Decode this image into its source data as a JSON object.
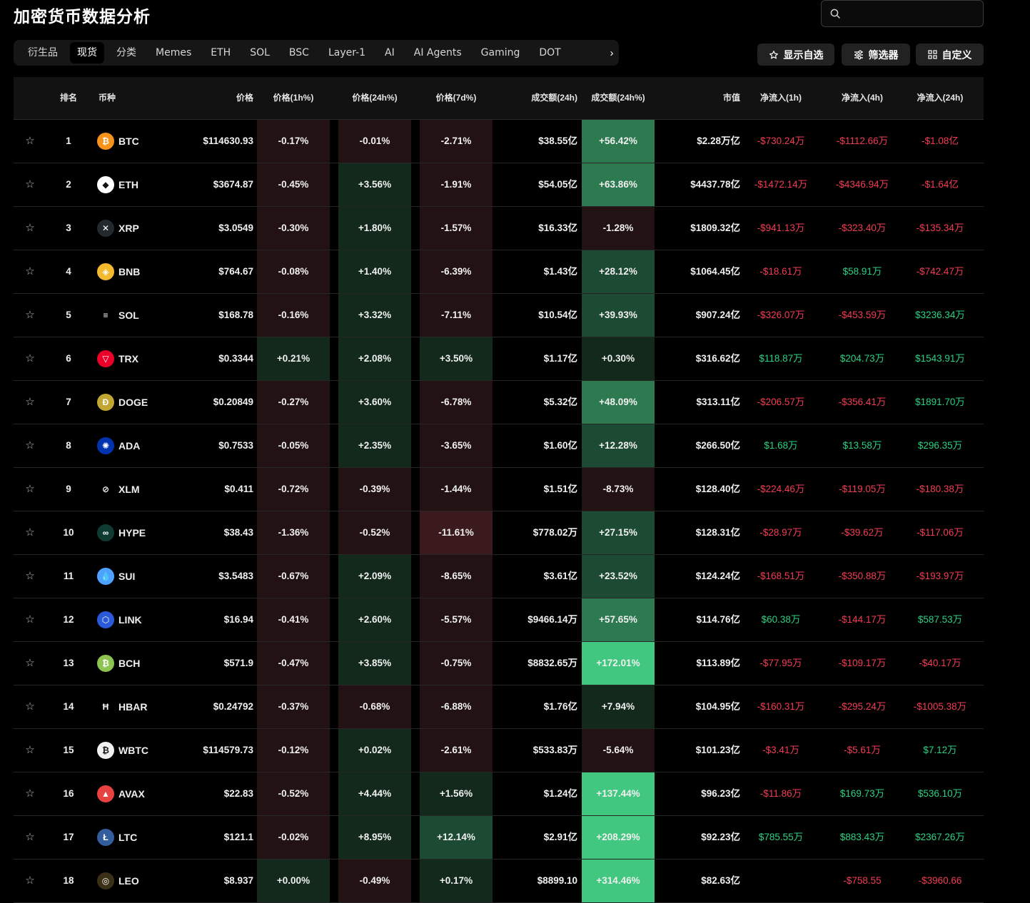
{
  "page": {
    "title": "加密货币数据分析"
  },
  "search": {
    "placeholder": ""
  },
  "tabs": [
    {
      "label": "衍生品",
      "active": false
    },
    {
      "label": "现货",
      "active": true
    },
    {
      "label": "分类",
      "active": false
    },
    {
      "label": "Memes",
      "active": false
    },
    {
      "label": "ETH",
      "active": false
    },
    {
      "label": "SOL",
      "active": false
    },
    {
      "label": "BSC",
      "active": false
    },
    {
      "label": "Layer-1",
      "active": false
    },
    {
      "label": "AI",
      "active": false
    },
    {
      "label": "AI Agents",
      "active": false
    },
    {
      "label": "Gaming",
      "active": false
    },
    {
      "label": "DOT",
      "active": false
    }
  ],
  "toolbar": {
    "watchlist_label": "显示自选",
    "filter_label": "筛选器",
    "customize_label": "自定义"
  },
  "colors": {
    "positive_text": "#2bd182",
    "negative_text": "#f23c54",
    "pos_strong": "#41c77f",
    "pos_medium": "#2d7a51",
    "pos_light": "#1d4a33",
    "pos_faint": "#12291c",
    "neg_light": "#3a1a1c",
    "neg_faint": "#221214"
  },
  "columns": {
    "rank": "排名",
    "coin": "币种",
    "price": "价格",
    "pct_1h": "价格(1h%)",
    "pct_24h": "价格(24h%)",
    "pct_7d": "价格(7d%)",
    "volume_24h": "成交额(24h)",
    "volume_pct_24h": "成交额(24h%)",
    "market_cap": "市值",
    "netflow_1h": "净流入(1h)",
    "netflow_4h": "净流入(4h)",
    "netflow_24h": "净流入(24h)"
  },
  "rows": [
    {
      "rank": "1",
      "symbol": "BTC",
      "icon": "bitcoin-icon",
      "icon_glyph": "₿",
      "icon_color": "#f7931a",
      "price": "$114630.93",
      "pct_1h": "-0.17%",
      "pct_24h": "-0.01%",
      "pct_7d": "-2.71%",
      "volume": "$38.55亿",
      "volume_pct": "+56.42%",
      "market_cap": "$2.28万亿",
      "flow_1h": "-$730.24万",
      "flow_4h": "-$1112.66万",
      "flow_24h": "-$1.08亿"
    },
    {
      "rank": "2",
      "symbol": "ETH",
      "icon": "ethereum-icon",
      "icon_glyph": "◆",
      "icon_color": "#ffffff",
      "price": "$3674.87",
      "pct_1h": "-0.45%",
      "pct_24h": "+3.56%",
      "pct_7d": "-1.91%",
      "volume": "$54.05亿",
      "volume_pct": "+63.86%",
      "market_cap": "$4437.78亿",
      "flow_1h": "-$1472.14万",
      "flow_4h": "-$4346.94万",
      "flow_24h": "-$1.64亿"
    },
    {
      "rank": "3",
      "symbol": "XRP",
      "icon": "xrp-icon",
      "icon_glyph": "✕",
      "icon_color": "#23292f",
      "price": "$3.0549",
      "pct_1h": "-0.30%",
      "pct_24h": "+1.80%",
      "pct_7d": "-1.57%",
      "volume": "$16.33亿",
      "volume_pct": "-1.28%",
      "market_cap": "$1809.32亿",
      "flow_1h": "-$941.13万",
      "flow_4h": "-$323.40万",
      "flow_24h": "-$135.34万"
    },
    {
      "rank": "4",
      "symbol": "BNB",
      "icon": "bnb-icon",
      "icon_glyph": "◈",
      "icon_color": "#f3ba2f",
      "price": "$764.67",
      "pct_1h": "-0.08%",
      "pct_24h": "+1.40%",
      "pct_7d": "-6.39%",
      "volume": "$1.43亿",
      "volume_pct": "+28.12%",
      "market_cap": "$1064.45亿",
      "flow_1h": "-$18.61万",
      "flow_4h": "$58.91万",
      "flow_24h": "-$742.47万"
    },
    {
      "rank": "5",
      "symbol": "SOL",
      "icon": "solana-icon",
      "icon_glyph": "≡",
      "icon_color": "#000000",
      "price": "$168.78",
      "pct_1h": "-0.16%",
      "pct_24h": "+3.32%",
      "pct_7d": "-7.11%",
      "volume": "$10.54亿",
      "volume_pct": "+39.93%",
      "market_cap": "$907.24亿",
      "flow_1h": "-$326.07万",
      "flow_4h": "-$453.59万",
      "flow_24h": "$3236.34万"
    },
    {
      "rank": "6",
      "symbol": "TRX",
      "icon": "tron-icon",
      "icon_glyph": "▽",
      "icon_color": "#eb0029",
      "price": "$0.3344",
      "pct_1h": "+0.21%",
      "pct_24h": "+2.08%",
      "pct_7d": "+3.50%",
      "volume": "$1.17亿",
      "volume_pct": "+0.30%",
      "market_cap": "$316.62亿",
      "flow_1h": "$118.87万",
      "flow_4h": "$204.73万",
      "flow_24h": "$1543.91万"
    },
    {
      "rank": "7",
      "symbol": "DOGE",
      "icon": "dogecoin-icon",
      "icon_glyph": "Ð",
      "icon_color": "#c2a633",
      "price": "$0.20849",
      "pct_1h": "-0.27%",
      "pct_24h": "+3.60%",
      "pct_7d": "-6.78%",
      "volume": "$5.32亿",
      "volume_pct": "+48.09%",
      "market_cap": "$313.11亿",
      "flow_1h": "-$206.57万",
      "flow_4h": "-$356.41万",
      "flow_24h": "$1891.70万"
    },
    {
      "rank": "8",
      "symbol": "ADA",
      "icon": "cardano-icon",
      "icon_glyph": "✺",
      "icon_color": "#0033ad",
      "price": "$0.7533",
      "pct_1h": "-0.05%",
      "pct_24h": "+2.35%",
      "pct_7d": "-3.65%",
      "volume": "$1.60亿",
      "volume_pct": "+12.28%",
      "market_cap": "$266.50亿",
      "flow_1h": "$1.68万",
      "flow_4h": "$13.58万",
      "flow_24h": "$296.35万"
    },
    {
      "rank": "9",
      "symbol": "XLM",
      "icon": "stellar-icon",
      "icon_glyph": "⊘",
      "icon_color": "#000000",
      "price": "$0.411",
      "pct_1h": "-0.72%",
      "pct_24h": "-0.39%",
      "pct_7d": "-1.44%",
      "volume": "$1.51亿",
      "volume_pct": "-8.73%",
      "market_cap": "$128.40亿",
      "flow_1h": "-$224.46万",
      "flow_4h": "-$119.05万",
      "flow_24h": "-$180.38万"
    },
    {
      "rank": "10",
      "symbol": "HYPE",
      "icon": "hyperliquid-icon",
      "icon_glyph": "∞",
      "icon_color": "#0f3b33",
      "price": "$38.43",
      "pct_1h": "-1.36%",
      "pct_24h": "-0.52%",
      "pct_7d": "-11.61%",
      "volume": "$778.02万",
      "volume_pct": "+27.15%",
      "market_cap": "$128.31亿",
      "flow_1h": "-$28.97万",
      "flow_4h": "-$39.62万",
      "flow_24h": "-$117.06万"
    },
    {
      "rank": "11",
      "symbol": "SUI",
      "icon": "sui-icon",
      "icon_glyph": "💧",
      "icon_color": "#4da2ff",
      "price": "$3.5483",
      "pct_1h": "-0.67%",
      "pct_24h": "+2.09%",
      "pct_7d": "-8.65%",
      "volume": "$3.61亿",
      "volume_pct": "+23.52%",
      "market_cap": "$124.24亿",
      "flow_1h": "-$168.51万",
      "flow_4h": "-$350.88万",
      "flow_24h": "-$193.97万"
    },
    {
      "rank": "12",
      "symbol": "LINK",
      "icon": "chainlink-icon",
      "icon_glyph": "⬡",
      "icon_color": "#2a5ada",
      "price": "$16.94",
      "pct_1h": "-0.41%",
      "pct_24h": "+2.60%",
      "pct_7d": "-5.57%",
      "volume": "$9466.14万",
      "volume_pct": "+57.65%",
      "market_cap": "$114.76亿",
      "flow_1h": "$60.38万",
      "flow_4h": "-$144.17万",
      "flow_24h": "$587.53万"
    },
    {
      "rank": "13",
      "symbol": "BCH",
      "icon": "bitcoin-cash-icon",
      "icon_glyph": "₿",
      "icon_color": "#8dc351",
      "price": "$571.9",
      "pct_1h": "-0.47%",
      "pct_24h": "+3.85%",
      "pct_7d": "-0.75%",
      "volume": "$8832.65万",
      "volume_pct": "+172.01%",
      "market_cap": "$113.89亿",
      "flow_1h": "-$77.95万",
      "flow_4h": "-$109.17万",
      "flow_24h": "-$40.17万"
    },
    {
      "rank": "14",
      "symbol": "HBAR",
      "icon": "hedera-icon",
      "icon_glyph": "Ħ",
      "icon_color": "#000000",
      "price": "$0.24792",
      "pct_1h": "-0.37%",
      "pct_24h": "-0.68%",
      "pct_7d": "-6.88%",
      "volume": "$1.76亿",
      "volume_pct": "+7.94%",
      "market_cap": "$104.95亿",
      "flow_1h": "-$160.31万",
      "flow_4h": "-$295.24万",
      "flow_24h": "-$1005.38万"
    },
    {
      "rank": "15",
      "symbol": "WBTC",
      "icon": "wrapped-bitcoin-icon",
      "icon_glyph": "₿",
      "icon_color": "#f1f1f1",
      "price": "$114579.73",
      "pct_1h": "-0.12%",
      "pct_24h": "+0.02%",
      "pct_7d": "-2.61%",
      "volume": "$533.83万",
      "volume_pct": "-5.64%",
      "market_cap": "$101.23亿",
      "flow_1h": "-$3.41万",
      "flow_4h": "-$5.61万",
      "flow_24h": "$7.12万"
    },
    {
      "rank": "16",
      "symbol": "AVAX",
      "icon": "avalanche-icon",
      "icon_glyph": "▲",
      "icon_color": "#e84142",
      "price": "$22.83",
      "pct_1h": "-0.52%",
      "pct_24h": "+4.44%",
      "pct_7d": "+1.56%",
      "volume": "$1.24亿",
      "volume_pct": "+137.44%",
      "market_cap": "$96.23亿",
      "flow_1h": "-$11.86万",
      "flow_4h": "$169.73万",
      "flow_24h": "$536.10万"
    },
    {
      "rank": "17",
      "symbol": "LTC",
      "icon": "litecoin-icon",
      "icon_glyph": "Ł",
      "icon_color": "#345d9d",
      "price": "$121.1",
      "pct_1h": "-0.02%",
      "pct_24h": "+8.95%",
      "pct_7d": "+12.14%",
      "volume": "$2.91亿",
      "volume_pct": "+208.29%",
      "market_cap": "$92.23亿",
      "flow_1h": "$785.55万",
      "flow_4h": "$883.43万",
      "flow_24h": "$2367.26万"
    },
    {
      "rank": "18",
      "symbol": "LEO",
      "icon": "leo-icon",
      "icon_glyph": "◎",
      "icon_color": "#3a3015",
      "price": "$8.937",
      "pct_1h": "+0.00%",
      "pct_24h": "-0.49%",
      "pct_7d": "+0.17%",
      "volume": "$8899.10",
      "volume_pct": "+314.46%",
      "market_cap": "$82.63亿",
      "flow_1h": "",
      "flow_4h": "-$758.55",
      "flow_24h": "-$3960.66"
    }
  ]
}
